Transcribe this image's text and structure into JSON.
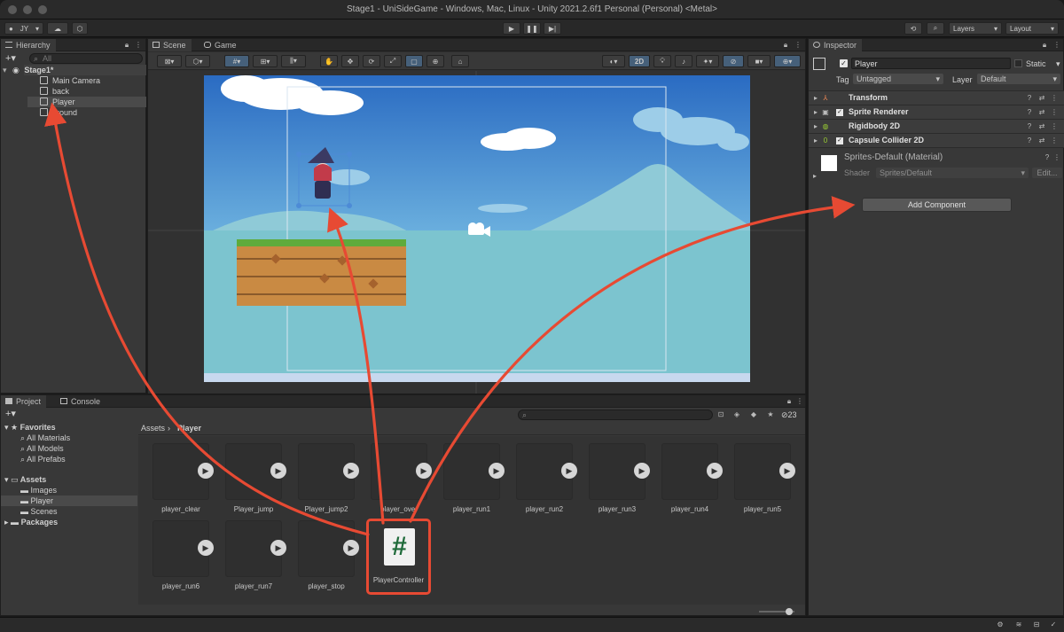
{
  "window": {
    "title": "Stage1 - UniSideGame - Windows, Mac, Linux - Unity 2021.2.6f1 Personal (Personal) <Metal>"
  },
  "toolbar": {
    "account": "JY",
    "layers": "Layers",
    "layout": "Layout"
  },
  "hierarchy": {
    "tab": "Hierarchy",
    "search_placeholder": "All",
    "scene": "Stage1*",
    "items": [
      "Main Camera",
      "back",
      "Player",
      "ground"
    ]
  },
  "scene_view": {
    "tabs": [
      "Scene",
      "Game"
    ],
    "mode_2d": "2D"
  },
  "inspector": {
    "tab": "Inspector",
    "object_name": "Player",
    "static_label": "Static",
    "tag_label": "Tag",
    "tag_value": "Untagged",
    "layer_label": "Layer",
    "layer_value": "Default",
    "components": [
      "Transform",
      "Sprite Renderer",
      "Rigidbody 2D",
      "Capsule Collider 2D"
    ],
    "material": {
      "name": "Sprites-Default (Material)",
      "shader_label": "Shader",
      "shader_value": "Sprites/Default",
      "edit_label": "Edit..."
    },
    "add_component": "Add Component"
  },
  "project": {
    "tabs": [
      "Project",
      "Console"
    ],
    "favorites_label": "Favorites",
    "favorites": [
      "All Materials",
      "All Models",
      "All Prefabs"
    ],
    "assets_label": "Assets",
    "asset_folders": [
      "Images",
      "Player",
      "Scenes"
    ],
    "packages_label": "Packages",
    "breadcrumb": [
      "Assets",
      "Player"
    ],
    "hidden_count": "23",
    "assets_row1": [
      "player_clear",
      "Player_jump",
      "Player_jump2",
      "player_over",
      "player_run1",
      "player_run2",
      "player_run3",
      "player_run4",
      "player_run5"
    ],
    "assets_row2": [
      "player_run6",
      "player_run7",
      "player_stop",
      "PlayerController"
    ],
    "script_glyph": "#"
  },
  "colors": {
    "accent_red": "#e74a33",
    "sky_top": "#2d6fc4",
    "sky_bottom": "#7cc4cf"
  }
}
